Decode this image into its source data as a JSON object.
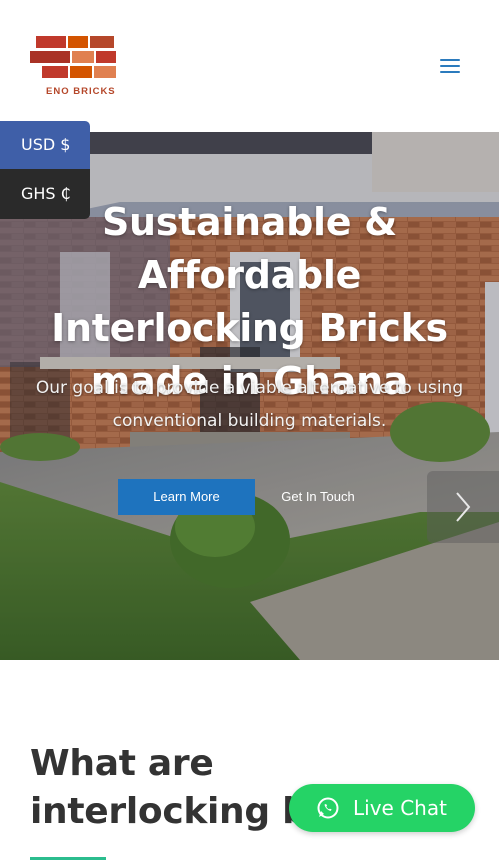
{
  "header": {
    "logo_text": "ENO BRICKS",
    "menu_icon": "hamburger-menu-icon"
  },
  "currency": {
    "usd": "USD $",
    "ghs": "GHS ₵"
  },
  "hero": {
    "title": "Sustainable & Affordable Interlocking Bricks made in Ghana",
    "subtitle": "Our goal is to provide a viable alternative to using conventional building materials.",
    "learn_more": "Learn More",
    "get_in_touch": "Get In Touch",
    "next_icon": "chevron-right-icon"
  },
  "section": {
    "title": "What are interlocking bricks?"
  },
  "live_chat": {
    "label": "Live Chat",
    "icon": "whatsapp-icon"
  },
  "colors": {
    "brand_brick": "#b5472a",
    "primary_blue": "#1e73be",
    "usd_bg": "#3f5fa8",
    "ghs_bg": "#2a2a2a",
    "whatsapp_green": "#25d366",
    "accent_green": "#2bbd8e"
  }
}
